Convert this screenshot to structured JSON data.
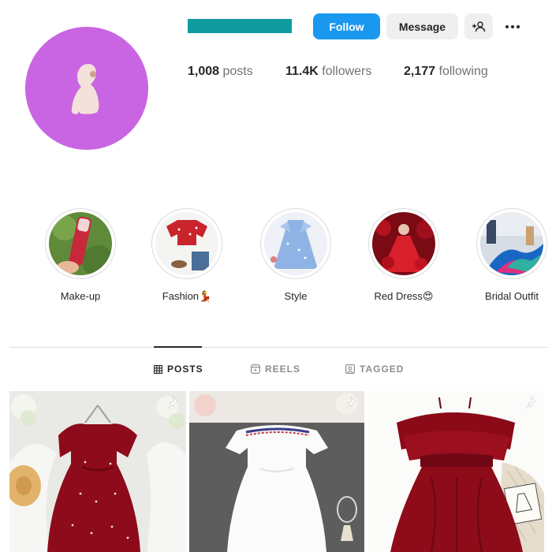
{
  "profile": {
    "username_color": "#0f9a9f",
    "avatar_color": "#c965e3"
  },
  "actions": {
    "follow_label": "Follow",
    "message_label": "Message",
    "suggest_icon": "add-person-icon",
    "more_icon": "more-options-icon"
  },
  "stats": {
    "posts_count": "1,008",
    "posts_label": "posts",
    "followers_count": "11.4K",
    "followers_label": "followers",
    "following_count": "2,177",
    "following_label": "following"
  },
  "highlights": [
    {
      "label": "Make-up"
    },
    {
      "label": "Fashion💃"
    },
    {
      "label": "Style"
    },
    {
      "label": "Red Dress😍"
    },
    {
      "label": "Bridal Outfit"
    }
  ],
  "tabs": [
    {
      "label": "POSTS",
      "icon": "grid-icon",
      "active": true
    },
    {
      "label": "REELS",
      "icon": "reels-icon",
      "active": false
    },
    {
      "label": "TAGGED",
      "icon": "tagged-icon",
      "active": false
    }
  ],
  "posts": [
    {
      "subject": "red velvet dress",
      "pinned": true
    },
    {
      "subject": "white off-shoulder dress",
      "pinned": true
    },
    {
      "subject": "red ruffle dress",
      "pinned": true
    }
  ],
  "colors": {
    "accent": "#1a98f0",
    "text": "#262626",
    "muted": "#737373"
  }
}
